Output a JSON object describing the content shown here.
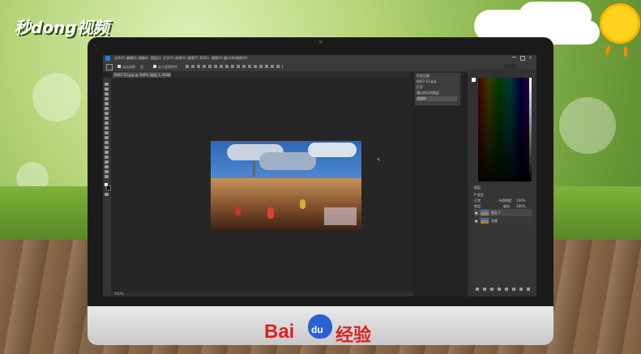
{
  "watermark": {
    "logo_text": "秒dong视频"
  },
  "brand": {
    "bai": "Bai",
    "du": "du",
    "jingyan": "经验"
  },
  "photoshop": {
    "menu": [
      "文件(F)",
      "编辑(E)",
      "图像(I)",
      "图层(L)",
      "文字(Y)",
      "选择(S)",
      "滤镜(T)",
      "3D(D)",
      "视图(V)",
      "窗口(W)",
      "帮助(H)"
    ],
    "options_bar": {
      "auto_select": "自动选择",
      "group": "组",
      "show_transform": "显示变换控件"
    },
    "doc_tab": "6067-53.jpg @ 100% (图层 1, RGB/8#) *",
    "status": "100%",
    "history": {
      "title": "历史记录",
      "rows": [
        "6067-53.jpg",
        "打开",
        "通过拷贝的图层",
        "滤镜库"
      ]
    },
    "layers": {
      "header": "图层",
      "kind": "P 类型",
      "blend": "正常",
      "opacity_label": "不透明度:",
      "opacity": "100%",
      "lock": "锁定:",
      "fill_label": "填充:",
      "fill": "100%",
      "items": [
        "图层 1",
        "背景"
      ]
    }
  },
  "colors": {
    "accent_red": "#dd2222",
    "baidu_blue": "#2b5fd6",
    "ps_dark": "#232323"
  }
}
